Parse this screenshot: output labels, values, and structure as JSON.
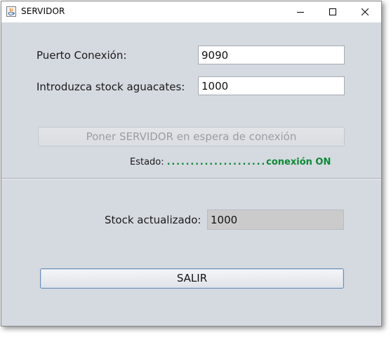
{
  "window": {
    "title": "SERVIDOR",
    "controls": [
      "minimize-icon",
      "maximize-icon",
      "close-icon"
    ]
  },
  "form": {
    "port_label": "Puerto Conexión:",
    "port_value": "9090",
    "stock_label": "Introduzca stock aguacates:",
    "stock_value": "1000",
    "wait_button_label": "Poner SERVIDOR en espera de conexión"
  },
  "status": {
    "label": "Estado:",
    "dots": ".....................",
    "value": "conexión ON",
    "color": "#0b8a34"
  },
  "stock_display": {
    "label": "Stock actualizado:",
    "value": "1000"
  },
  "exit_button_label": "SALIR"
}
